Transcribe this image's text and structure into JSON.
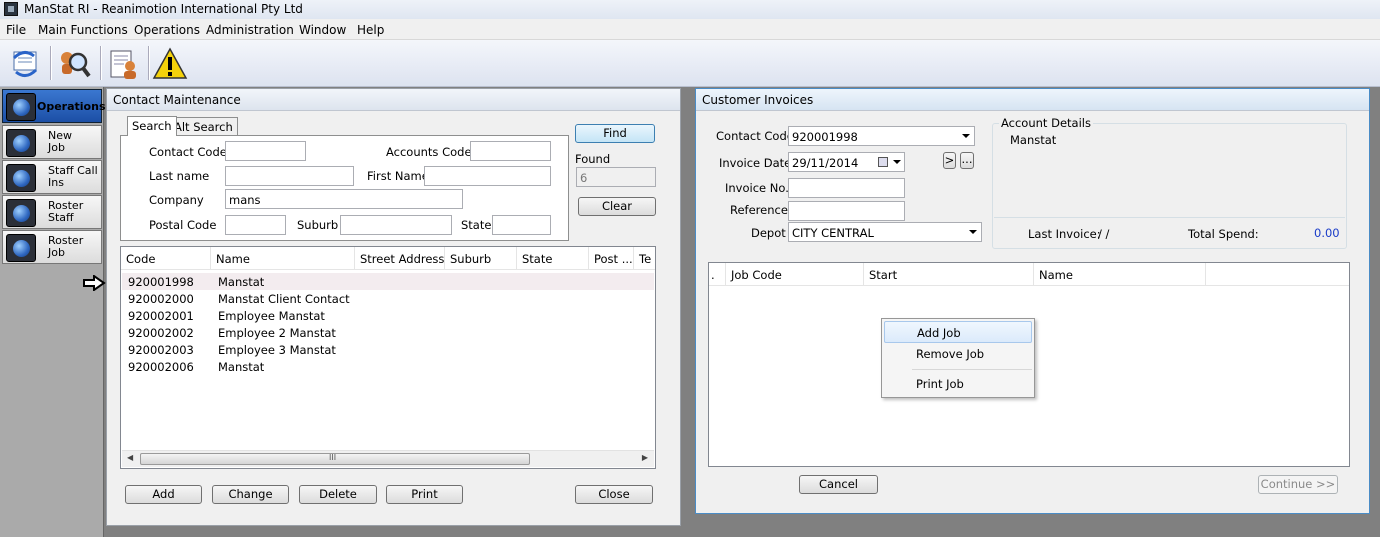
{
  "window": {
    "title": "ManStat RI - Reanimotion International Pty Ltd"
  },
  "menu": [
    "File",
    "Main Functions",
    "Operations",
    "Administration",
    "Window",
    "Help"
  ],
  "toolbar": {
    "icons": [
      "refresh-icon",
      "search-magnifier-icon",
      "contact-document-icon",
      "warning-icon"
    ]
  },
  "nav": {
    "header": "Operations",
    "items": [
      {
        "label": "New\nJob"
      },
      {
        "label": "Staff Call\nIns"
      },
      {
        "label": "Roster\nStaff"
      },
      {
        "label": "Roster\nJob"
      }
    ]
  },
  "contact": {
    "title": "Contact Maintenance",
    "tabs": [
      "Search",
      "Alt Search"
    ],
    "labels": {
      "contact_code": "Contact Code",
      "accounts_code": "Accounts Code",
      "last_name": "Last name",
      "first_name": "First Name",
      "company": "Company",
      "postal_code": "Postal Code",
      "suburb": "Suburb",
      "state": "State"
    },
    "values": {
      "contact_code": "",
      "accounts_code": "",
      "last_name": "",
      "first_name": "",
      "company": "mans",
      "postal_code": "",
      "suburb": "",
      "state": ""
    },
    "find": "Find",
    "found_label": "Found",
    "found_count": "6",
    "clear": "Clear",
    "columns": [
      "Code",
      "Name",
      "Street Address",
      "Suburb",
      "State",
      "Post ...",
      "Te"
    ],
    "rows": [
      {
        "code": "920001998",
        "name": "Manstat"
      },
      {
        "code": "920002000",
        "name": "Manstat  Client Contact"
      },
      {
        "code": "920002001",
        "name": "Employee  Manstat"
      },
      {
        "code": "920002002",
        "name": "Employee 2  Manstat"
      },
      {
        "code": "920002003",
        "name": "Employee 3  Manstat"
      },
      {
        "code": "920002006",
        "name": "Manstat"
      }
    ],
    "scroll_grip": "III",
    "buttons": {
      "add": "Add",
      "change": "Change",
      "delete": "Delete",
      "print": "Print",
      "close": "Close"
    }
  },
  "invoices": {
    "title": "Customer Invoices",
    "labels": {
      "contact_code": "Contact Code :",
      "invoice_date": "Invoice Date :",
      "invoice_no": "Invoice No. :",
      "reference": "Reference :",
      "depot": "Depot :"
    },
    "values": {
      "contact_code": "920001998",
      "invoice_date": "29/11/2014",
      "invoice_no": "",
      "reference": "",
      "depot": "CITY CENTRAL"
    },
    "next_btn": ">",
    "more_btn": "...",
    "account": {
      "legend": "Account Details",
      "name": "Manstat",
      "last_invoice_label": "Last Invoice:",
      "last_invoice_value": "/ /",
      "total_spend_label": "Total Spend:",
      "total_spend_value": "0.00"
    },
    "columns": [
      ".",
      "Job Code",
      "Start",
      "Name"
    ],
    "context_menu": [
      "Add Job",
      "Remove Job",
      "Print Job"
    ],
    "buttons": {
      "cancel": "Cancel",
      "continue": "Continue >>"
    }
  }
}
